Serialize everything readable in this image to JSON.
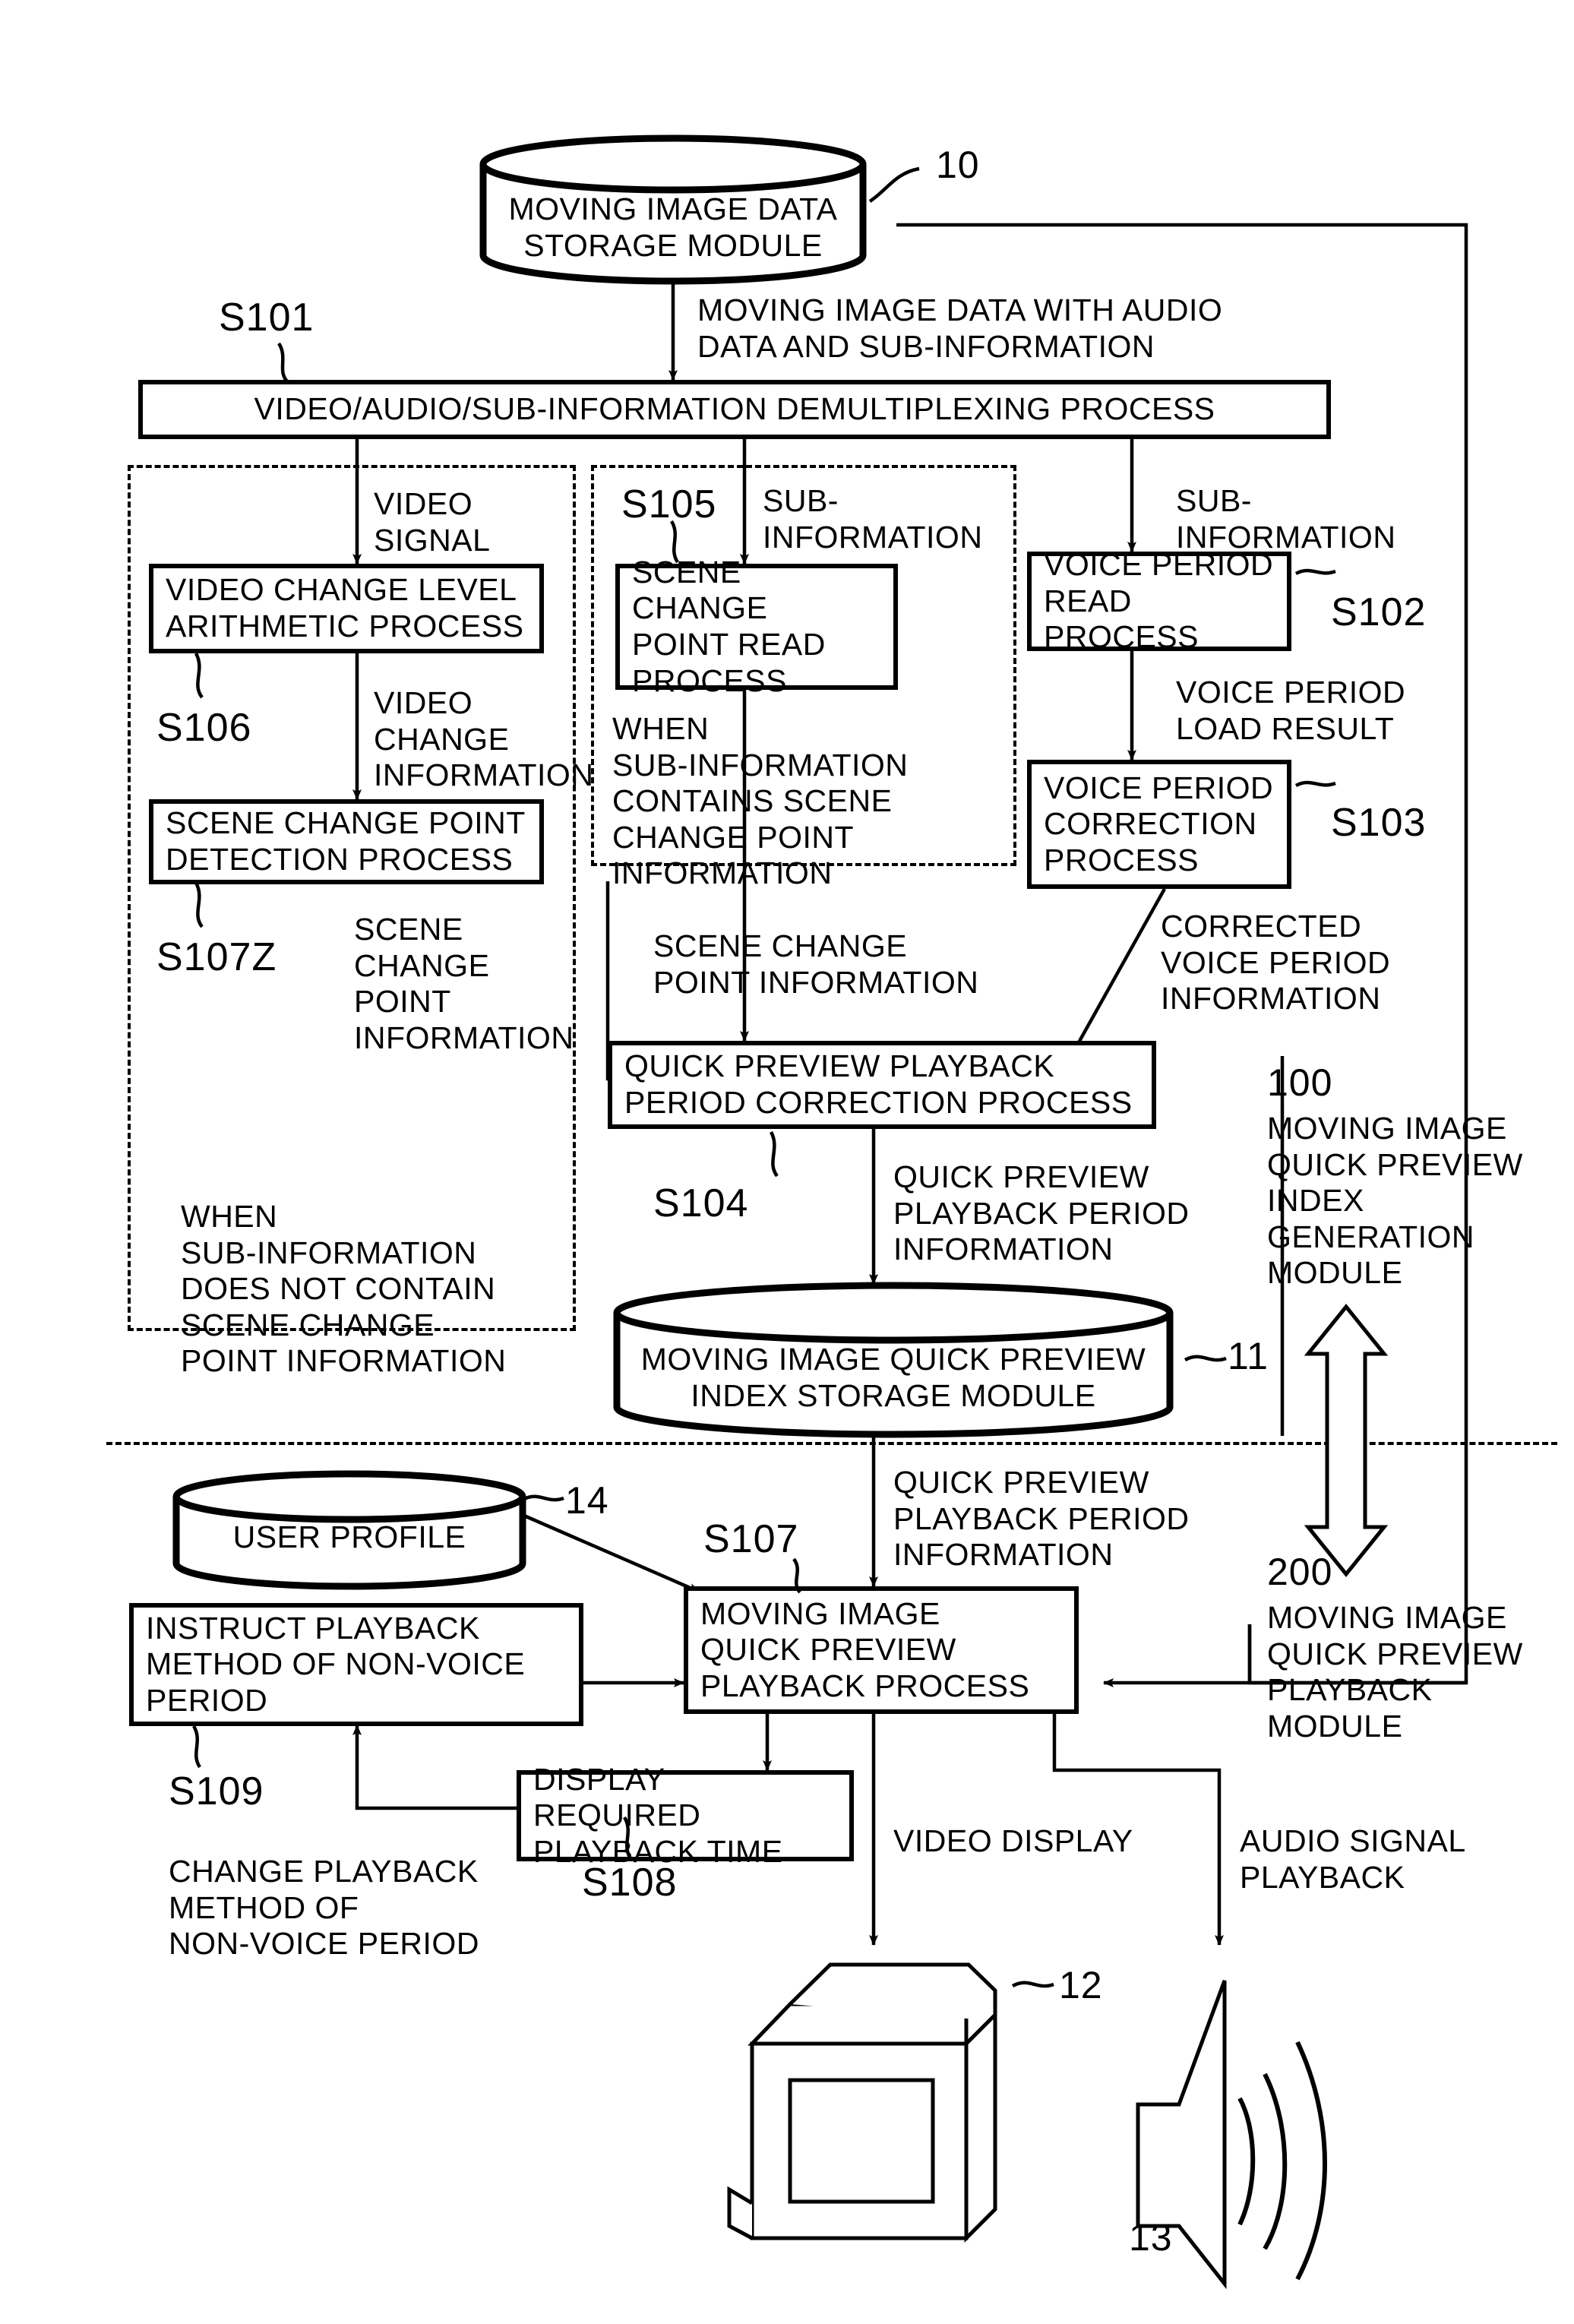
{
  "diagram": {
    "type": "patent-flow-diagram",
    "storage_modules": [
      {
        "id": "10",
        "label": "MOVING  IMAGE  DATA\nSTORAGE MODULE",
        "ref": "10"
      },
      {
        "id": "11",
        "label": "MOVING IMAGE QUICK PREVIEW\nINDEX STORAGE MODULE",
        "ref": "11"
      },
      {
        "id": "14",
        "label": "USER PROFILE",
        "ref": "14"
      }
    ],
    "process_boxes": [
      {
        "step": "S101",
        "label": "VIDEO/AUDIO/SUB-INFORMATION DEMULTIPLEXING PROCESS"
      },
      {
        "step": "S106",
        "label": "VIDEO CHANGE LEVEL\nARITHMETIC PROCESS"
      },
      {
        "step": "S107Z",
        "label": "SCENE CHANGE POINT\nDETECTION PROCESS"
      },
      {
        "step": "S105",
        "label": "SCENE CHANGE\nPOINT READ\nPROCESS"
      },
      {
        "step": "S102",
        "label": "VOICE PERIOD\nREAD PROCESS"
      },
      {
        "step": "S103",
        "label": "VOICE PERIOD\nCORRECTION\nPROCESS"
      },
      {
        "step": "S104",
        "label": "QUICK PREVIEW PLAYBACK\nPERIOD CORRECTION PROCESS"
      },
      {
        "step": "S107",
        "label": "MOVING  IMAGE\nQUICK PREVIEW\nPLAYBACK PROCESS"
      },
      {
        "step": "S109",
        "label": "INSTRUCT PLAYBACK\nMETHOD OF NON-VOICE\nPERIOD"
      },
      {
        "step": "S108",
        "label": "DISPLAY REQUIRED\nPLAYBACK TIME"
      }
    ],
    "edge_labels": [
      "MOVING  IMAGE  DATA  WITH  AUDIO\nDATA  AND  SUB-INFORMATION",
      "VIDEO\nSIGNAL",
      "SUB-\nINFORMATION",
      "SUB-\nINFORMATION",
      "VIDEO\nCHANGE\nINFORMATION",
      "VOICE PERIOD\nLOAD RESULT",
      "SCENE\nCHANGE\nPOINT\nINFORMATION",
      "SCENE CHANGE\nPOINT INFORMATION",
      "CORRECTED\nVOICE PERIOD\nINFORMATION",
      "QUICK PREVIEW\nPLAYBACK PERIOD\nINFORMATION",
      "QUICK PREVIEW\nPLAYBACK PERIOD\nINFORMATION",
      "VIDEO DISPLAY",
      "AUDIO SIGNAL\nPLAYBACK",
      "CHANGE PLAYBACK\nMETHOD OF\nNON-VOICE PERIOD"
    ],
    "condition_notes": [
      "WHEN\nSUB-INFORMATION\nCONTAINS SCENE\nCHANGE POINT\nINFORMATION",
      "WHEN\nSUB-INFORMATION\nDOES NOT CONTAIN\nSCENE CHANGE\nPOINT INFORMATION"
    ],
    "module_groups": [
      {
        "ref": "100",
        "label": "MOVING  IMAGE\nQUICK  PREVIEW\nINDEX\nGENERATION\nMODULE"
      },
      {
        "ref": "200",
        "label": "MOVING  IMAGE\nQUICK  PREVIEW\nPLAYBACK\nMODULE"
      }
    ],
    "devices": [
      {
        "ref": "12",
        "name": "monitor-display"
      },
      {
        "ref": "13",
        "name": "speaker"
      }
    ]
  },
  "top": {
    "storage10_label": "MOVING  IMAGE  DATA\nSTORAGE MODULE",
    "ref10": "10",
    "step101": "S101",
    "demux_label": "VIDEO/AUDIO/SUB-INFORMATION DEMULTIPLEXING PROCESS",
    "edge_from_storage": "MOVING  IMAGE  DATA  WITH  AUDIO\nDATA  AND  SUB-INFORMATION"
  },
  "left_branch": {
    "edge_video_signal": "VIDEO\nSIGNAL",
    "box_s106_label": "VIDEO CHANGE LEVEL\nARITHMETIC PROCESS",
    "step106": "S106",
    "edge_video_change": "VIDEO\nCHANGE\nINFORMATION",
    "box_s107z_label": "SCENE CHANGE POINT\nDETECTION PROCESS",
    "step107z": "S107Z",
    "edge_scene_change_pt": "SCENE\nCHANGE\nPOINT\nINFORMATION",
    "note": "WHEN\nSUB-INFORMATION\nDOES NOT CONTAIN\nSCENE CHANGE\nPOINT INFORMATION"
  },
  "mid_branch": {
    "step105": "S105",
    "edge_subinfo": "SUB-\nINFORMATION",
    "box_s105_label": "SCENE CHANGE\nPOINT READ\nPROCESS",
    "note": "WHEN\nSUB-INFORMATION\nCONTAINS SCENE\nCHANGE POINT\nINFORMATION",
    "edge_scene_change_pt": "SCENE CHANGE\nPOINT INFORMATION"
  },
  "right_branch": {
    "edge_subinfo": "SUB-\nINFORMATION",
    "box_s102_label": "VOICE PERIOD\nREAD PROCESS",
    "step102": "S102",
    "edge_voice_load": "VOICE PERIOD\nLOAD RESULT",
    "box_s103_label": "VOICE PERIOD\nCORRECTION\nPROCESS",
    "step103": "S103",
    "edge_corrected_voice": "CORRECTED\nVOICE PERIOD\nINFORMATION"
  },
  "center": {
    "box_s104_label": "QUICK PREVIEW PLAYBACK\nPERIOD CORRECTION PROCESS",
    "step104": "S104",
    "edge_qpp_info": "QUICK PREVIEW\nPLAYBACK PERIOD\nINFORMATION",
    "storage11_label": "MOVING IMAGE QUICK PREVIEW\nINDEX STORAGE MODULE",
    "ref11": "11"
  },
  "module_100": {
    "ref": "100",
    "label": "MOVING  IMAGE\nQUICK  PREVIEW\nINDEX\nGENERATION\nMODULE"
  },
  "module_200": {
    "ref": "200",
    "label": "MOVING  IMAGE\nQUICK  PREVIEW\nPLAYBACK\nMODULE"
  },
  "bottom": {
    "storage14_label": "USER PROFILE",
    "ref14": "14",
    "edge_qpp_info": "QUICK PREVIEW\nPLAYBACK PERIOD\nINFORMATION",
    "step107": "S107",
    "box_s107_label": "MOVING  IMAGE\nQUICK PREVIEW\nPLAYBACK PROCESS",
    "box_s109_label": "INSTRUCT PLAYBACK\nMETHOD OF NON-VOICE\nPERIOD",
    "step109": "S109",
    "note_change_playback": "CHANGE PLAYBACK\nMETHOD OF\nNON-VOICE PERIOD",
    "box_s108_label": "DISPLAY REQUIRED\nPLAYBACK TIME",
    "step108": "S108",
    "edge_video_display": "VIDEO DISPLAY",
    "edge_audio_playback": "AUDIO SIGNAL\nPLAYBACK",
    "ref12": "12",
    "ref13": "13"
  }
}
